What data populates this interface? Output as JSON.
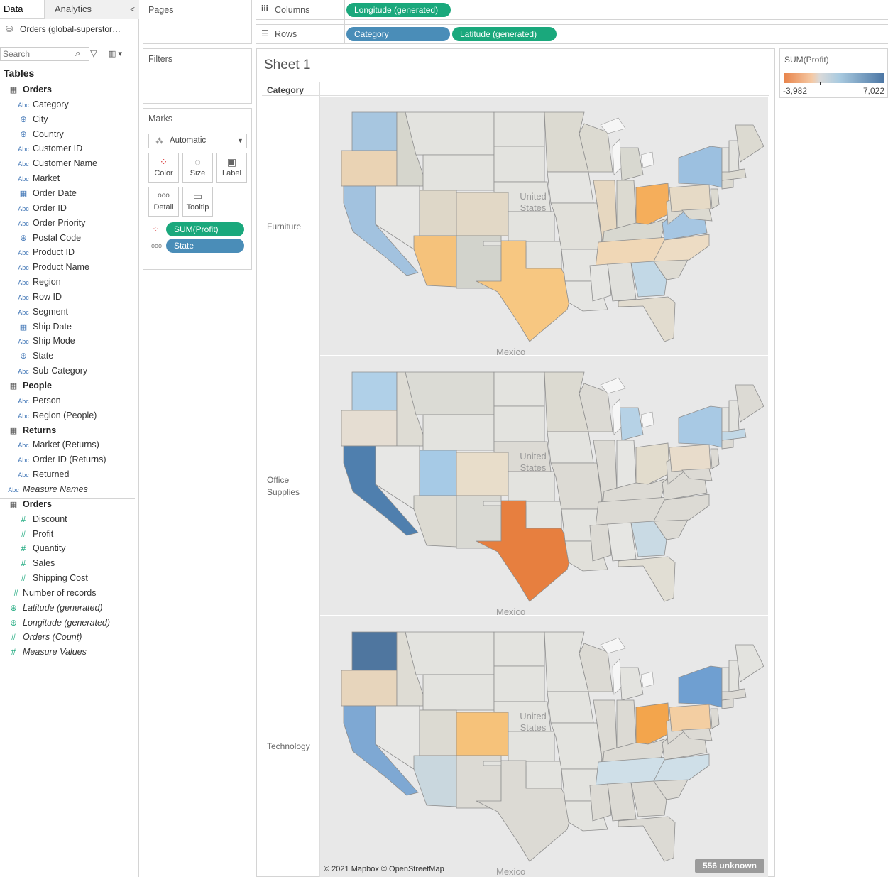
{
  "tabs": {
    "data": "Data",
    "analytics": "Analytics",
    "collapse": "<"
  },
  "source": {
    "label": "Orders (global-superstor…"
  },
  "search": {
    "placeholder": "Search"
  },
  "tables_heading": "Tables",
  "fields": [
    {
      "kind": "table",
      "label": "Orders"
    },
    {
      "kind": "dim",
      "type": "Abc",
      "label": "Category"
    },
    {
      "kind": "geo",
      "type": "⊕",
      "label": "City"
    },
    {
      "kind": "geo",
      "type": "⊕",
      "label": "Country"
    },
    {
      "kind": "dim",
      "type": "Abc",
      "label": "Customer ID"
    },
    {
      "kind": "dim",
      "type": "Abc",
      "label": "Customer Name"
    },
    {
      "kind": "dim",
      "type": "Abc",
      "label": "Market"
    },
    {
      "kind": "date",
      "type": "▦",
      "label": "Order Date"
    },
    {
      "kind": "dim",
      "type": "Abc",
      "label": "Order ID"
    },
    {
      "kind": "dim",
      "type": "Abc",
      "label": "Order Priority"
    },
    {
      "kind": "geo",
      "type": "⊕",
      "label": "Postal Code"
    },
    {
      "kind": "dim",
      "type": "Abc",
      "label": "Product ID"
    },
    {
      "kind": "dim",
      "type": "Abc",
      "label": "Product Name"
    },
    {
      "kind": "dim",
      "type": "Abc",
      "label": "Region"
    },
    {
      "kind": "dim",
      "type": "Abc",
      "label": "Row ID"
    },
    {
      "kind": "dim",
      "type": "Abc",
      "label": "Segment"
    },
    {
      "kind": "date",
      "type": "▦",
      "label": "Ship Date"
    },
    {
      "kind": "dim",
      "type": "Abc",
      "label": "Ship Mode"
    },
    {
      "kind": "geo",
      "type": "⊕",
      "label": "State"
    },
    {
      "kind": "dim",
      "type": "Abc",
      "label": "Sub-Category"
    },
    {
      "kind": "table",
      "label": "People"
    },
    {
      "kind": "dim",
      "type": "Abc",
      "label": "Person"
    },
    {
      "kind": "dim",
      "type": "Abc",
      "label": "Region (People)"
    },
    {
      "kind": "table",
      "label": "Returns"
    },
    {
      "kind": "dim",
      "type": "Abc",
      "label": "Market (Returns)"
    },
    {
      "kind": "dim",
      "type": "Abc",
      "label": "Order ID (Returns)"
    },
    {
      "kind": "dim",
      "type": "Abc",
      "label": "Returned"
    },
    {
      "kind": "topit",
      "type": "Abc",
      "label": "Measure Names"
    },
    {
      "kind": "table",
      "label": "Orders"
    },
    {
      "kind": "meas",
      "type": "#",
      "label": "Discount"
    },
    {
      "kind": "meas",
      "type": "#",
      "label": "Profit"
    },
    {
      "kind": "meas",
      "type": "#",
      "label": "Quantity"
    },
    {
      "kind": "meas",
      "type": "#",
      "label": "Sales"
    },
    {
      "kind": "meas",
      "type": "#",
      "label": "Shipping Cost"
    },
    {
      "kind": "top",
      "type": "=#",
      "label": "Number of records"
    },
    {
      "kind": "topit",
      "type": "⊕",
      "label": "Latitude (generated)"
    },
    {
      "kind": "topit",
      "type": "⊕",
      "label": "Longitude (generated)"
    },
    {
      "kind": "topit",
      "type": "#",
      "label": "Orders (Count)"
    },
    {
      "kind": "topit",
      "type": "#",
      "label": "Measure Values"
    }
  ],
  "pages": {
    "title": "Pages"
  },
  "filters": {
    "title": "Filters"
  },
  "marks": {
    "title": "Marks",
    "mark_type": "Automatic",
    "buttons": [
      "Color",
      "Size",
      "Label",
      "Detail",
      "Tooltip"
    ],
    "pills": [
      {
        "label": "SUM(Profit)"
      },
      {
        "label": "State"
      }
    ]
  },
  "shelves": {
    "columns_label": "Columns",
    "columns_pill": "Longitude (generated)",
    "rows_label": "Rows",
    "rows_pills": [
      "Category",
      "Latitude (generated)"
    ]
  },
  "view": {
    "title": "Sheet 1",
    "category_header": "Category",
    "categories": [
      "Furniture",
      "Office Supplies",
      "Technology"
    ],
    "map_country_label": "United States",
    "map_south_label": "Mexico",
    "attribution": "© 2021 Mapbox © OpenStreetMap",
    "unknown_badge": "556 unknown"
  },
  "legend": {
    "title": "SUM(Profit)",
    "min": "-3,982",
    "max": "7,022",
    "color_low": "#e8834a",
    "color_mid": "#d9d9d9",
    "color_high": "#4b76a4"
  },
  "colors": {
    "pill_green": "#1aa87c",
    "pill_blue": "#4a8db8"
  }
}
